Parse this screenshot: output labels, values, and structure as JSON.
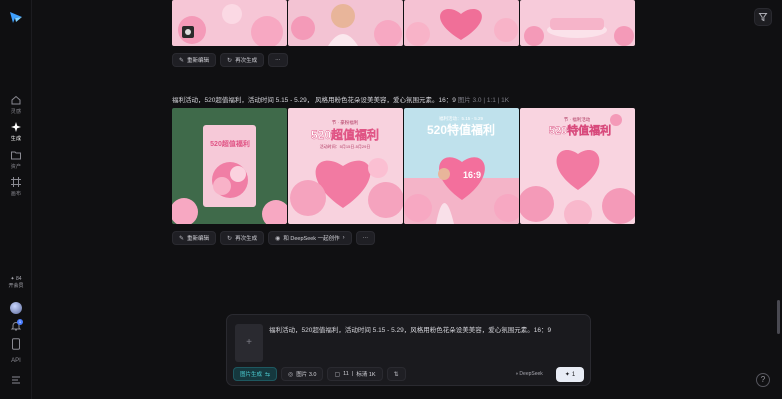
{
  "sidebar": {
    "items": [
      {
        "label": "灵感"
      },
      {
        "label": "生成"
      },
      {
        "label": "资产"
      },
      {
        "label": "画布"
      }
    ],
    "credits_value": "84",
    "credits_label": "开会员",
    "notification_count": "1",
    "api_label": "API"
  },
  "row1": {
    "buttons": {
      "reedit": "重新编辑",
      "regenerate": "再次生成",
      "more": "···"
    }
  },
  "row2": {
    "prompt": "福利活动，520超值福利，活动时间 5.15 - 5.29， 风格用粉色花朵设美美容，爱心氛围元素。16：9",
    "meta": "图片 3.0 | 1:1 | 1K",
    "images": [
      {
        "title": "520超值福利",
        "sub": ""
      },
      {
        "title": "520超值福利",
        "sub": "节 · 豪粉福利",
        "date": "活动时间：5月15日-5月29日"
      },
      {
        "title": "520特值福利",
        "sub": "福利活动：5.15 - 5.29",
        "ratio": "16:9"
      },
      {
        "title": "520特值福利",
        "sub": "节 · 福利活动"
      }
    ],
    "buttons": {
      "reedit": "重新编辑",
      "regenerate": "再次生成",
      "deepseek": "和 DeepSeek 一起创作",
      "more": "···"
    }
  },
  "composer": {
    "text": "福利活动，520超值福利，活动时间 5.15 - 5.29，风格用粉色花朵设美美容，爱心氛围元素。16：9",
    "tools": {
      "mode": "图片生成",
      "model": "图片 3.0",
      "ratio": "11",
      "quality": "标清 1K"
    },
    "deepseek_label": "DeepSeek",
    "send_count": "1"
  },
  "colors": {
    "accent": "#4ed1d6",
    "pink": "#f7b6cc",
    "bg": "#101012"
  }
}
